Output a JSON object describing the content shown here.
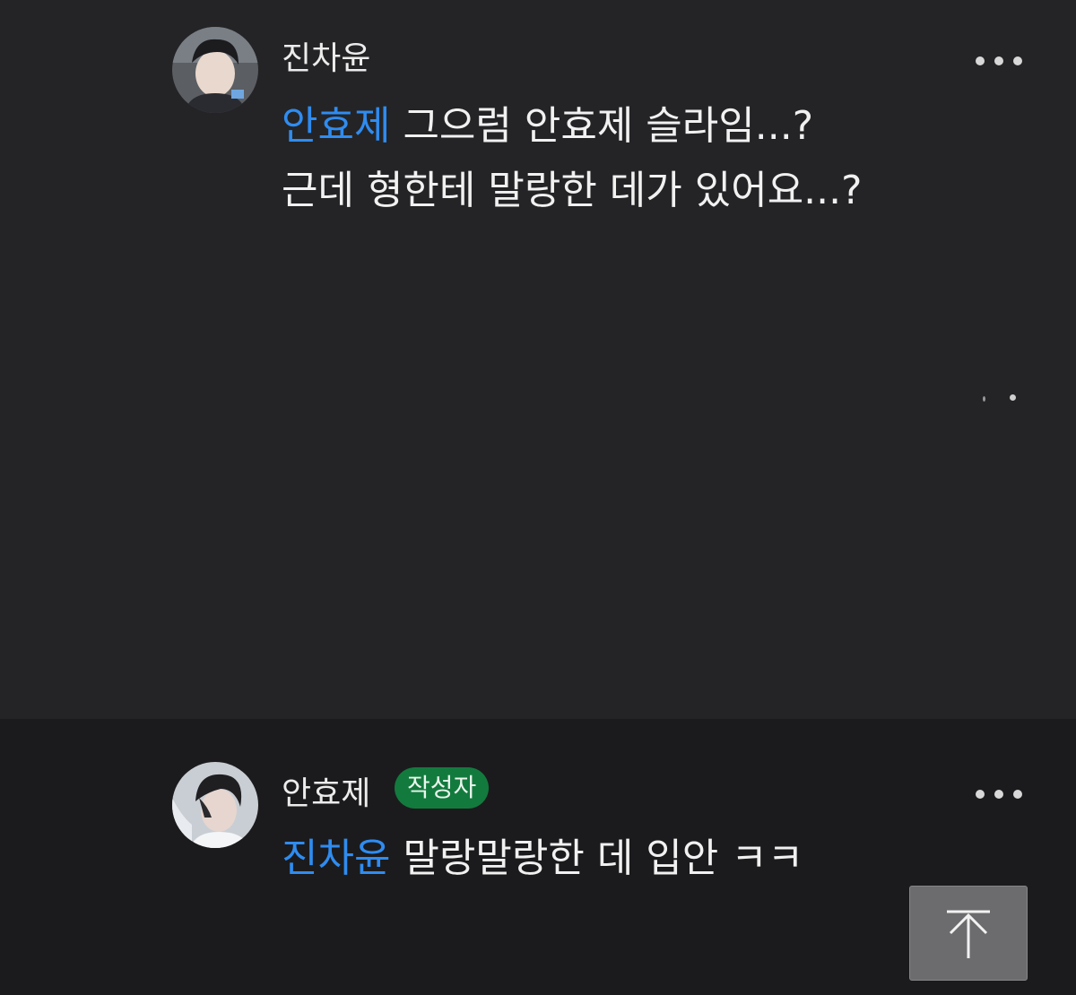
{
  "comments": [
    {
      "author": "진차윤",
      "mention": "안효제",
      "lines": [
        "그으럼 안효제 슬라임...?",
        "근데 형한테 말랑한 데가 있어요...?"
      ],
      "more_icon": "more-horizontal-icon"
    },
    {
      "author": "안효제",
      "badge": "작성자",
      "mention": "진차윤",
      "lines": [
        "말랑말랑한 데 입안 ㅋㅋ"
      ],
      "more_icon": "more-horizontal-icon"
    }
  ],
  "scroll_top_icon": "arrow-up-to-top-icon",
  "colors": {
    "mention": "#2f8cf0",
    "badge_bg": "#137a3e",
    "comment_bg": "#242426",
    "page_bg": "#1b1b1d"
  }
}
